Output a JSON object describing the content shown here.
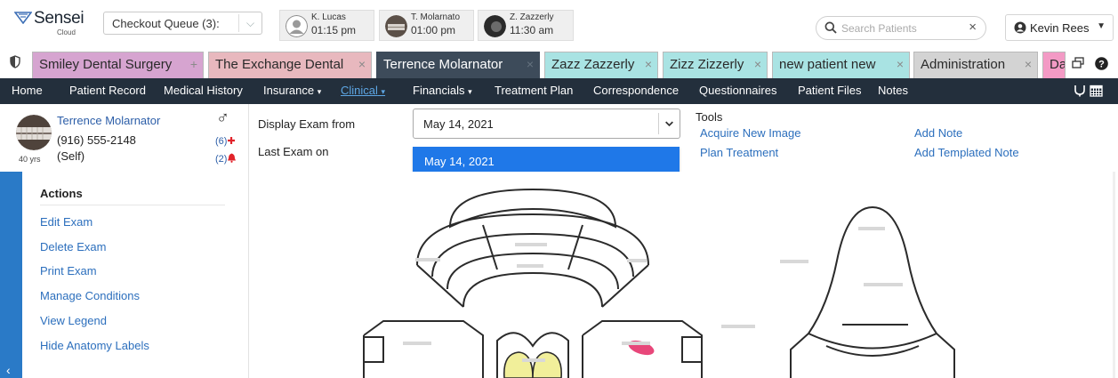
{
  "branding": {
    "logo_text": "Sensei",
    "logo_sub": "Cloud"
  },
  "queue": {
    "label": "Checkout Queue (3):"
  },
  "appointments": [
    {
      "name": "K. Lucas",
      "time": "01:15 pm"
    },
    {
      "name": "T. Molarnato",
      "time": "01:00 pm"
    },
    {
      "name": "Z. Zazzerly",
      "time": "11:30 am"
    }
  ],
  "search": {
    "placeholder": "Search Patients",
    "clear": "×"
  },
  "user": {
    "name": "Kevin Rees"
  },
  "tabs": [
    {
      "label": "Smiley Dental Surgery",
      "close": "+",
      "color": "#d6a4d0"
    },
    {
      "label": "The Exchange Dental",
      "close": "×",
      "color": "#e8b8be"
    },
    {
      "label": "Terrence Molarnator",
      "close": "×",
      "color": "#3d4b5a"
    },
    {
      "label": "Zazz Zazzerly",
      "close": "×",
      "color": "#a9e3e3"
    },
    {
      "label": "Zizz Zizzerly",
      "close": "×",
      "color": "#a9e3e3"
    },
    {
      "label": "new patient new",
      "close": "×",
      "color": "#a9e3e3"
    },
    {
      "label": "Administration",
      "close": "×",
      "color": "#d3d3d3"
    },
    {
      "label": "Da",
      "close": "",
      "color": "#f39ac5"
    }
  ],
  "nav": [
    {
      "label": "Home",
      "caret": ""
    },
    {
      "label": "Patient Record",
      "caret": ""
    },
    {
      "label": "Medical History",
      "caret": ""
    },
    {
      "label": "Insurance",
      "caret": "▾"
    },
    {
      "label": "Clinical",
      "caret": "▾"
    },
    {
      "label": "Financials",
      "caret": "▾"
    },
    {
      "label": "Treatment Plan",
      "caret": ""
    },
    {
      "label": "Correspondence",
      "caret": ""
    },
    {
      "label": "Questionnaires",
      "caret": ""
    },
    {
      "label": "Patient Files",
      "caret": ""
    },
    {
      "label": "Notes",
      "caret": ""
    }
  ],
  "patient": {
    "name": "Terrence Molarnator",
    "phone": "(916) 555-2148",
    "relation": "(Self)",
    "age": "40 yrs",
    "gender_symbol": "♂",
    "count_medical": "(6)",
    "count_alerts": "(2)"
  },
  "exam": {
    "display_label": "Display Exam from",
    "last_label": "Last Exam on",
    "selected_date": "May 14, 2021",
    "options": [
      "May 14, 2021"
    ]
  },
  "tools": {
    "title": "Tools",
    "links": [
      "Acquire New Image",
      "Add Note",
      "Plan Treatment",
      "Add Templated Note"
    ]
  },
  "actions": {
    "title": "Actions",
    "links": [
      "Edit Exam",
      "Delete Exam",
      "Print Exam",
      "Manage Conditions",
      "View Legend",
      "Hide Anatomy Labels"
    ]
  },
  "colors": {
    "nav_bg": "#232f3c",
    "accent_blue": "#2c6fbd",
    "dropdown_highlight": "#1f78e8",
    "alert_red": "#e1232a",
    "lesion_pink": "#e8477a",
    "tooth_yellow": "#f1ef9a"
  }
}
